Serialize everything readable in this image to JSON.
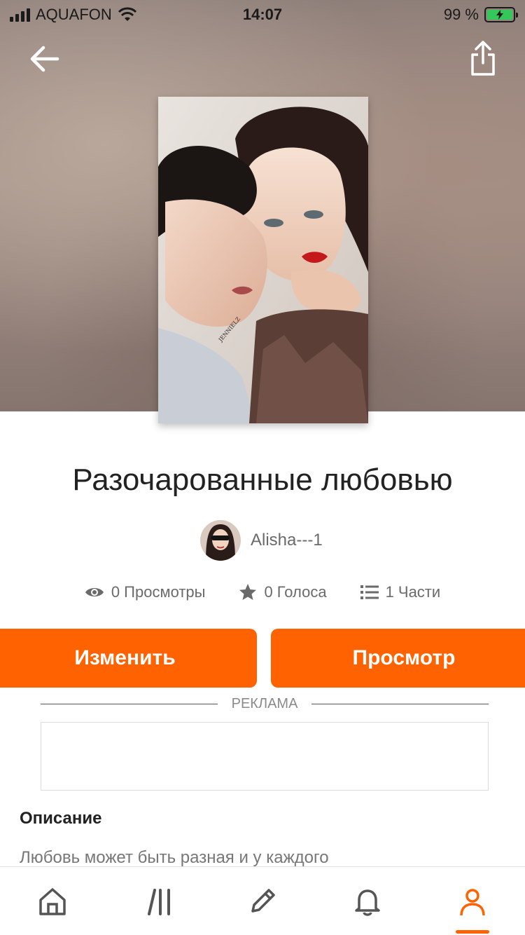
{
  "status_bar": {
    "carrier": "AQUAFON",
    "time": "14:07",
    "battery": "99 %"
  },
  "story": {
    "title": "Разочарованные любовью",
    "author": "Alisha---1",
    "cover_watermark": "JENNIELZ"
  },
  "stats": {
    "views": "0 Просмотры",
    "votes": "0 Голоса",
    "parts": "1 Части"
  },
  "actions": {
    "edit_label": "Изменить",
    "view_label": "Просмотр"
  },
  "ad": {
    "label": "РЕКЛАМА"
  },
  "description": {
    "heading": "Описание",
    "text": "Любовь может быть разная и у каждого"
  },
  "nav": {
    "items": [
      "home-icon",
      "library-icon",
      "write-icon",
      "notifications-icon",
      "profile-icon"
    ],
    "active": "profile-icon"
  },
  "colors": {
    "accent": "#ff6200",
    "battery": "#34c759"
  }
}
